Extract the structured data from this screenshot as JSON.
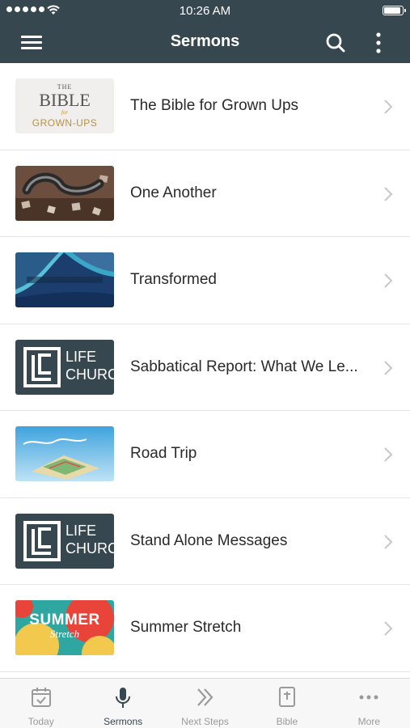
{
  "status_bar": {
    "time": "10:26 AM"
  },
  "navbar": {
    "title": "Sermons",
    "menu_icon": "hamburger-icon",
    "search_icon": "search-icon",
    "more_icon": "more-vertical-icon"
  },
  "sermons": [
    {
      "title": "The Bible for Grown Ups",
      "thumb": {
        "line1": "THE",
        "line2": "BIBLE",
        "line3": "for",
        "line4": "GROWN-UPS"
      }
    },
    {
      "title": "One Another"
    },
    {
      "title": "Transformed"
    },
    {
      "title": "Sabbatical Report: What We Le...",
      "thumb": {
        "line1": "LIFE",
        "line2": "CHURCH"
      }
    },
    {
      "title": "Road Trip"
    },
    {
      "title": "Stand Alone Messages",
      "thumb": {
        "line1": "LIFE",
        "line2": "CHURCH"
      }
    },
    {
      "title": "Summer Stretch",
      "thumb": {
        "line1": "SUMMER",
        "line2": "Stretch"
      }
    }
  ],
  "tabs": [
    {
      "label": "Today",
      "icon": "calendar-icon"
    },
    {
      "label": "Sermons",
      "icon": "microphone-icon",
      "active": true
    },
    {
      "label": "Next Steps",
      "icon": "double-chevron-icon"
    },
    {
      "label": "Bible",
      "icon": "bible-icon"
    },
    {
      "label": "More",
      "icon": "more-horizontal-icon"
    }
  ],
  "colors": {
    "nav": "#36474f",
    "active_tab": "#36474f",
    "inactive_tab": "#9a9a9a"
  }
}
